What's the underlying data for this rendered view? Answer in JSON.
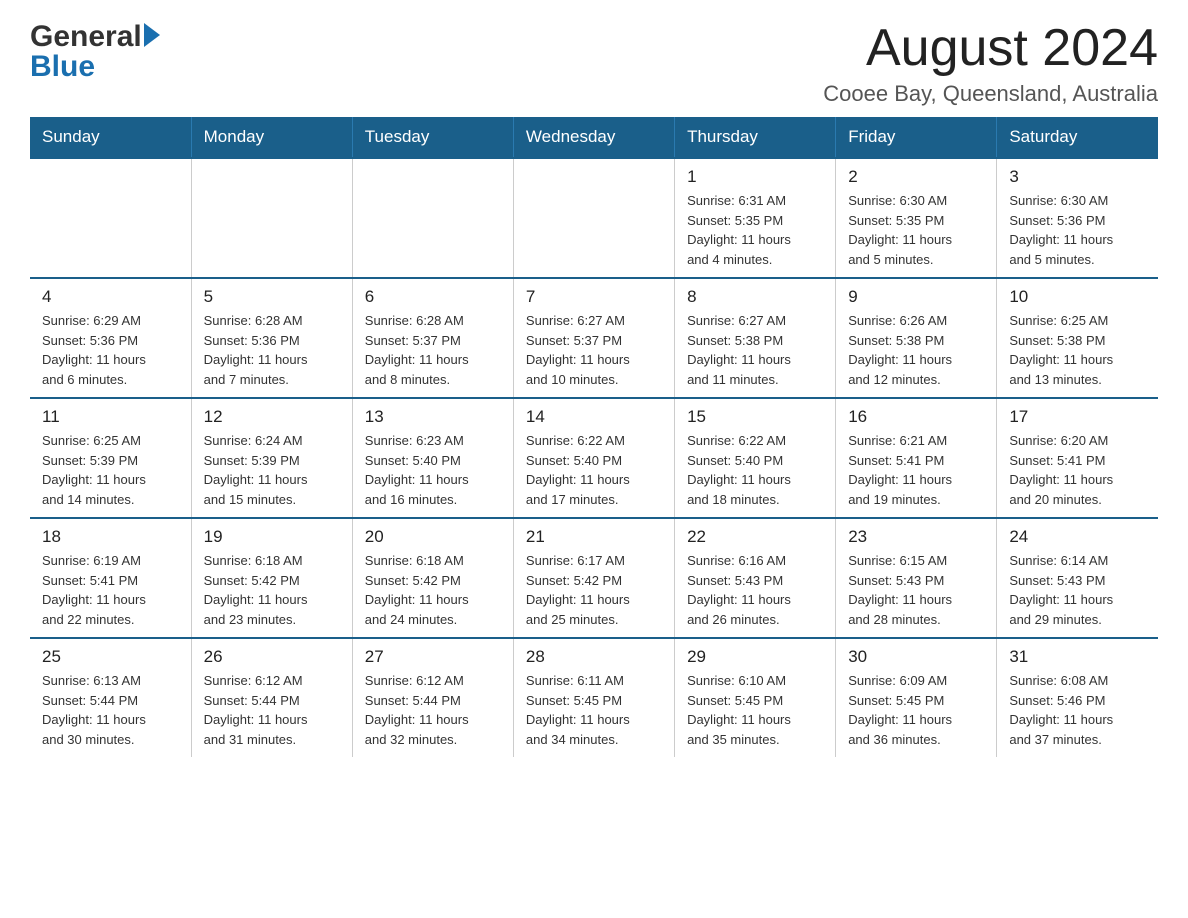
{
  "header": {
    "logo_general": "General",
    "logo_blue": "Blue",
    "title": "August 2024",
    "subtitle": "Cooee Bay, Queensland, Australia"
  },
  "weekdays": [
    "Sunday",
    "Monday",
    "Tuesday",
    "Wednesday",
    "Thursday",
    "Friday",
    "Saturday"
  ],
  "weeks": [
    [
      {
        "day": "",
        "info": ""
      },
      {
        "day": "",
        "info": ""
      },
      {
        "day": "",
        "info": ""
      },
      {
        "day": "",
        "info": ""
      },
      {
        "day": "1",
        "info": "Sunrise: 6:31 AM\nSunset: 5:35 PM\nDaylight: 11 hours\nand 4 minutes."
      },
      {
        "day": "2",
        "info": "Sunrise: 6:30 AM\nSunset: 5:35 PM\nDaylight: 11 hours\nand 5 minutes."
      },
      {
        "day": "3",
        "info": "Sunrise: 6:30 AM\nSunset: 5:36 PM\nDaylight: 11 hours\nand 5 minutes."
      }
    ],
    [
      {
        "day": "4",
        "info": "Sunrise: 6:29 AM\nSunset: 5:36 PM\nDaylight: 11 hours\nand 6 minutes."
      },
      {
        "day": "5",
        "info": "Sunrise: 6:28 AM\nSunset: 5:36 PM\nDaylight: 11 hours\nand 7 minutes."
      },
      {
        "day": "6",
        "info": "Sunrise: 6:28 AM\nSunset: 5:37 PM\nDaylight: 11 hours\nand 8 minutes."
      },
      {
        "day": "7",
        "info": "Sunrise: 6:27 AM\nSunset: 5:37 PM\nDaylight: 11 hours\nand 10 minutes."
      },
      {
        "day": "8",
        "info": "Sunrise: 6:27 AM\nSunset: 5:38 PM\nDaylight: 11 hours\nand 11 minutes."
      },
      {
        "day": "9",
        "info": "Sunrise: 6:26 AM\nSunset: 5:38 PM\nDaylight: 11 hours\nand 12 minutes."
      },
      {
        "day": "10",
        "info": "Sunrise: 6:25 AM\nSunset: 5:38 PM\nDaylight: 11 hours\nand 13 minutes."
      }
    ],
    [
      {
        "day": "11",
        "info": "Sunrise: 6:25 AM\nSunset: 5:39 PM\nDaylight: 11 hours\nand 14 minutes."
      },
      {
        "day": "12",
        "info": "Sunrise: 6:24 AM\nSunset: 5:39 PM\nDaylight: 11 hours\nand 15 minutes."
      },
      {
        "day": "13",
        "info": "Sunrise: 6:23 AM\nSunset: 5:40 PM\nDaylight: 11 hours\nand 16 minutes."
      },
      {
        "day": "14",
        "info": "Sunrise: 6:22 AM\nSunset: 5:40 PM\nDaylight: 11 hours\nand 17 minutes."
      },
      {
        "day": "15",
        "info": "Sunrise: 6:22 AM\nSunset: 5:40 PM\nDaylight: 11 hours\nand 18 minutes."
      },
      {
        "day": "16",
        "info": "Sunrise: 6:21 AM\nSunset: 5:41 PM\nDaylight: 11 hours\nand 19 minutes."
      },
      {
        "day": "17",
        "info": "Sunrise: 6:20 AM\nSunset: 5:41 PM\nDaylight: 11 hours\nand 20 minutes."
      }
    ],
    [
      {
        "day": "18",
        "info": "Sunrise: 6:19 AM\nSunset: 5:41 PM\nDaylight: 11 hours\nand 22 minutes."
      },
      {
        "day": "19",
        "info": "Sunrise: 6:18 AM\nSunset: 5:42 PM\nDaylight: 11 hours\nand 23 minutes."
      },
      {
        "day": "20",
        "info": "Sunrise: 6:18 AM\nSunset: 5:42 PM\nDaylight: 11 hours\nand 24 minutes."
      },
      {
        "day": "21",
        "info": "Sunrise: 6:17 AM\nSunset: 5:42 PM\nDaylight: 11 hours\nand 25 minutes."
      },
      {
        "day": "22",
        "info": "Sunrise: 6:16 AM\nSunset: 5:43 PM\nDaylight: 11 hours\nand 26 minutes."
      },
      {
        "day": "23",
        "info": "Sunrise: 6:15 AM\nSunset: 5:43 PM\nDaylight: 11 hours\nand 28 minutes."
      },
      {
        "day": "24",
        "info": "Sunrise: 6:14 AM\nSunset: 5:43 PM\nDaylight: 11 hours\nand 29 minutes."
      }
    ],
    [
      {
        "day": "25",
        "info": "Sunrise: 6:13 AM\nSunset: 5:44 PM\nDaylight: 11 hours\nand 30 minutes."
      },
      {
        "day": "26",
        "info": "Sunrise: 6:12 AM\nSunset: 5:44 PM\nDaylight: 11 hours\nand 31 minutes."
      },
      {
        "day": "27",
        "info": "Sunrise: 6:12 AM\nSunset: 5:44 PM\nDaylight: 11 hours\nand 32 minutes."
      },
      {
        "day": "28",
        "info": "Sunrise: 6:11 AM\nSunset: 5:45 PM\nDaylight: 11 hours\nand 34 minutes."
      },
      {
        "day": "29",
        "info": "Sunrise: 6:10 AM\nSunset: 5:45 PM\nDaylight: 11 hours\nand 35 minutes."
      },
      {
        "day": "30",
        "info": "Sunrise: 6:09 AM\nSunset: 5:45 PM\nDaylight: 11 hours\nand 36 minutes."
      },
      {
        "day": "31",
        "info": "Sunrise: 6:08 AM\nSunset: 5:46 PM\nDaylight: 11 hours\nand 37 minutes."
      }
    ]
  ]
}
